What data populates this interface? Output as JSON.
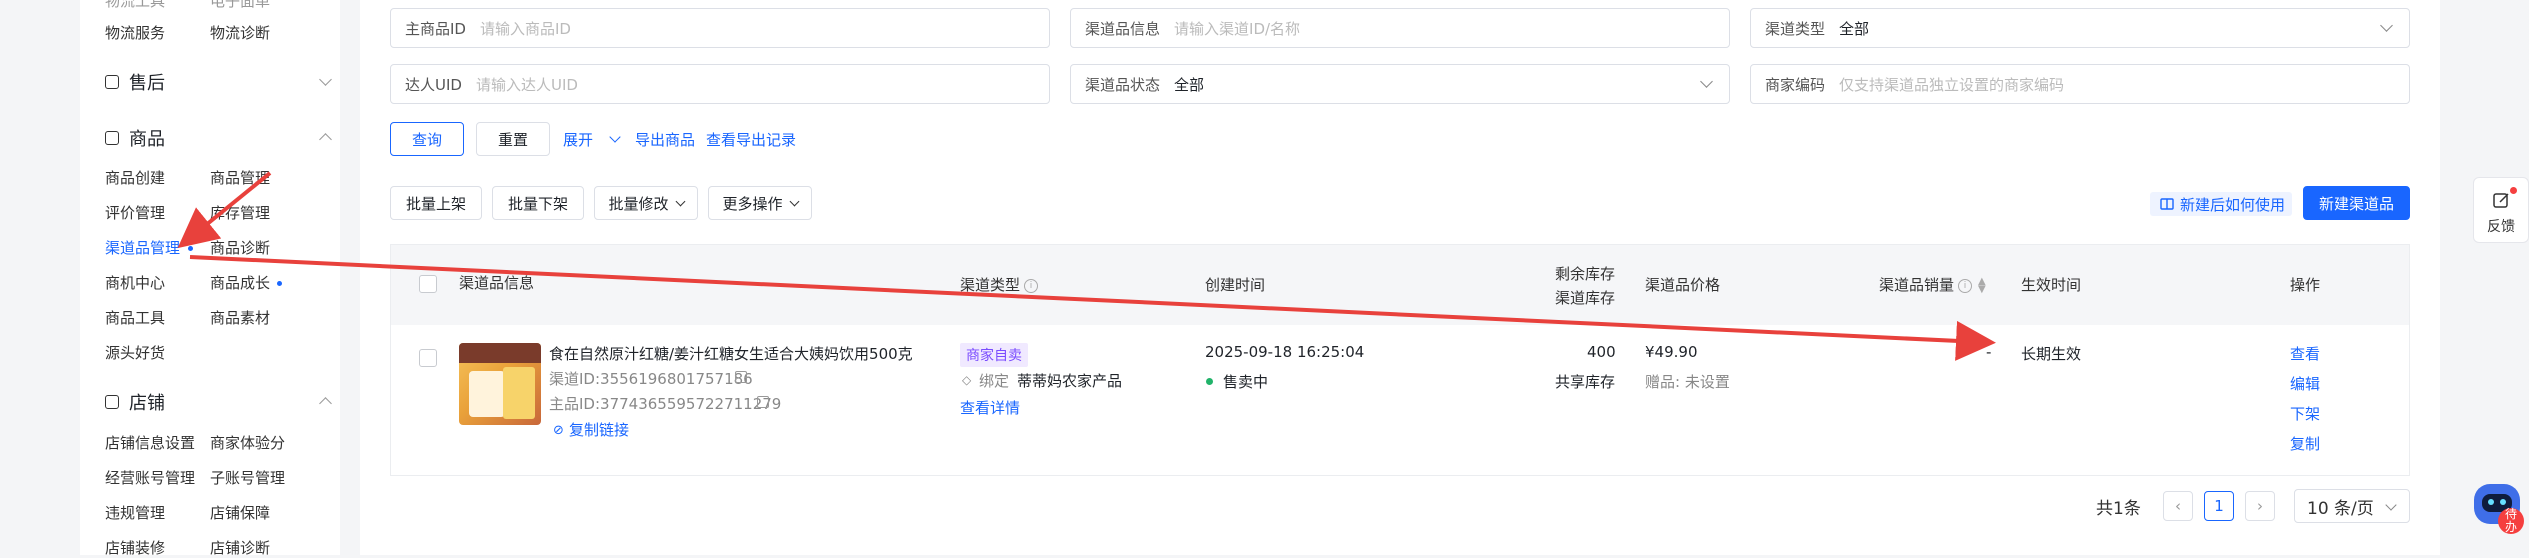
{
  "sidebar": {
    "top_items": [
      "物流工具",
      "电子面单",
      "物流服务",
      "物流诊断"
    ],
    "sections": [
      {
        "title": "售后",
        "icon": "after-sale-icon",
        "expanded": false,
        "items": []
      },
      {
        "title": "商品",
        "icon": "product-icon",
        "expanded": true,
        "items": [
          "商品创建",
          "商品管理",
          "评价管理",
          "库存管理",
          "渠道品管理",
          "商品诊断",
          "商机中心",
          "商品成长",
          "商品工具",
          "商品素材",
          "源头好货"
        ]
      },
      {
        "title": "店铺",
        "icon": "shop-icon",
        "expanded": true,
        "items": [
          "店铺信息设置",
          "商家体验分",
          "经营账号管理",
          "子账号管理",
          "违规管理",
          "店铺保障",
          "店铺装修",
          "店铺诊断"
        ]
      }
    ]
  },
  "filters": {
    "main_id": {
      "label": "主商品ID",
      "placeholder": "请输入商品ID"
    },
    "channel_info": {
      "label": "渠道品信息",
      "placeholder": "请输入渠道ID/名称"
    },
    "channel_type": {
      "label": "渠道类型",
      "value": "全部"
    },
    "talent_uid": {
      "label": "达人UID",
      "placeholder": "请输入达人UID"
    },
    "channel_status": {
      "label": "渠道品状态",
      "value": "全部"
    },
    "merchant_code": {
      "label": "商家编码",
      "placeholder": "仅支持渠道品独立设置的商家编码"
    }
  },
  "actions": {
    "query": "查询",
    "reset": "重置",
    "expand": "展开",
    "export": "导出商品",
    "export_log": "查看导出记录"
  },
  "toolbar": {
    "batch_on": "批量上架",
    "batch_off": "批量下架",
    "batch_edit": "批量修改",
    "more": "更多操作",
    "howto": "新建后如何使用",
    "create": "新建渠道品"
  },
  "table": {
    "headers": {
      "info": "渠道品信息",
      "type": "渠道类型",
      "created": "创建时间",
      "stock_1": "剩余库存",
      "stock_2": "渠道库存",
      "price": "渠道品价格",
      "sales": "渠道品销量",
      "effective": "生效时间",
      "ops": "操作"
    },
    "row": {
      "title": "食在自然原汁红糖/姜汁红糖女生适合大姨妈饮用500克",
      "channel_id": "渠道ID:3556196801757186",
      "main_id": "主品ID:3774365595722711279",
      "copy_link": "复制链接",
      "type_tag": "商家自卖",
      "bind_label": "绑定",
      "bind_value": "蒂蒂妈农家产品",
      "view_detail": "查看详情",
      "created": "2025-09-18 16:25:04",
      "status": "售卖中",
      "stock": "400",
      "stock_share": "共享库存",
      "price": "¥49.90",
      "gift": "赠品: 未设置",
      "sales": "-",
      "effective": "长期生效",
      "ops": [
        "查看",
        "编辑",
        "下架",
        "复制"
      ]
    }
  },
  "pagination": {
    "total": "共1条",
    "current": "1",
    "page_size": "10 条/页"
  },
  "float": {
    "feedback": "反馈",
    "assistant_badge": "待办"
  },
  "colors": {
    "accent": "#1966ff",
    "annotation_arrow": "#e8413c",
    "status_green": "#21b36a"
  }
}
